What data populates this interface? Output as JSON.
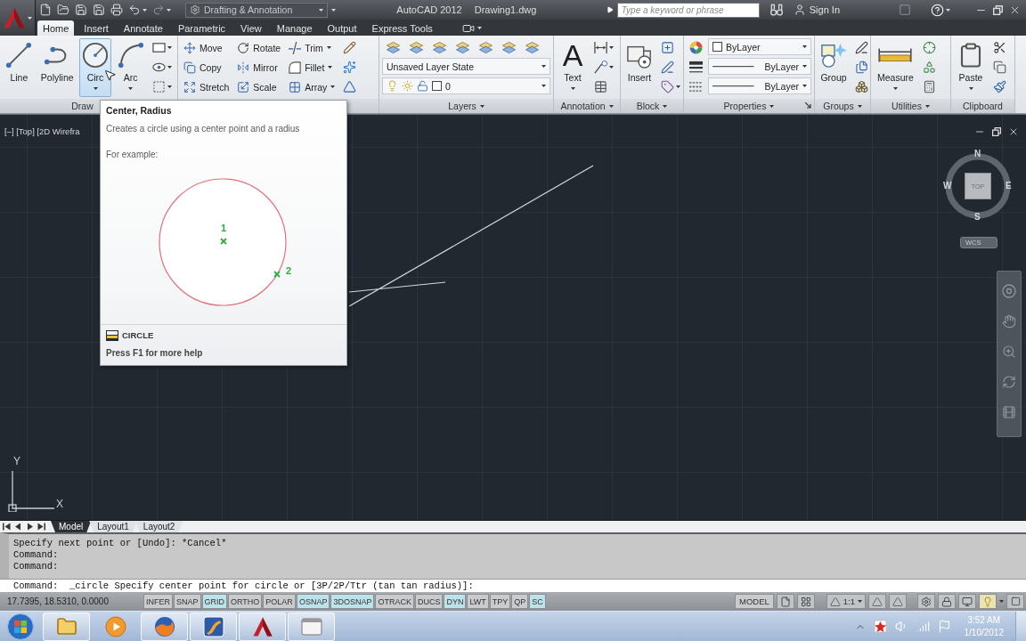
{
  "title_bar": {
    "workspace": "Drafting & Annotation",
    "app_name": "AutoCAD 2012",
    "document": "Drawing1.dwg",
    "search": {
      "placeholder": "Type a keyword or phrase"
    },
    "sign_in": "Sign In"
  },
  "tabs": [
    {
      "label": "Home",
      "selected": true
    },
    {
      "label": "Insert",
      "selected": false
    },
    {
      "label": "Annotate",
      "selected": false
    },
    {
      "label": "Parametric",
      "selected": false
    },
    {
      "label": "View",
      "selected": false
    },
    {
      "label": "Manage",
      "selected": false
    },
    {
      "label": "Output",
      "selected": false
    },
    {
      "label": "Express Tools",
      "selected": false
    }
  ],
  "ribbon": {
    "panels": [
      {
        "title": "Draw",
        "menu": false,
        "launcher": false,
        "large_buttons": [
          {
            "label": "Line",
            "menu": false,
            "hovered": false
          },
          {
            "label": "Polyline",
            "menu": false,
            "hovered": false
          },
          {
            "label": "Circ",
            "menu": true,
            "hovered": true
          },
          {
            "label": "Arc",
            "menu": true,
            "hovered": false
          }
        ],
        "tools": [
          [
            {
              "kind": "icon",
              "menu": true
            },
            {
              "kind": "icon",
              "menu": true
            },
            {
              "kind": "icon",
              "menu": true
            }
          ]
        ]
      },
      {
        "tools": [
          [
            {
              "kind": "tool",
              "label": "Move",
              "menu": false
            },
            {
              "kind": "tool",
              "label": "Copy",
              "menu": false
            },
            {
              "kind": "tool",
              "label": "Stretch",
              "menu": false
            }
          ],
          [
            {
              "kind": "tool",
              "label": "Rotate",
              "menu": false
            },
            {
              "kind": "tool",
              "label": "Mirror",
              "menu": false
            },
            {
              "kind": "tool",
              "label": "Scale",
              "menu": false
            }
          ],
          [
            {
              "kind": "tool",
              "label": "Trim",
              "menu": true
            },
            {
              "kind": "tool",
              "label": "Fillet",
              "menu": true
            },
            {
              "kind": "tool",
              "label": "Array",
              "menu": true
            }
          ],
          [
            {
              "kind": "icon",
              "menu": false
            },
            {
              "kind": "icon",
              "menu": false
            },
            {
              "kind": "icon",
              "menu": false
            }
          ]
        ]
      },
      {
        "title": "Layers",
        "menu": true,
        "launcher": false,
        "tools": [
          [
            {
              "kind": "icon_row",
              "items": [
                {
                  "menu": false
                },
                {
                  "menu": false
                },
                {
                  "menu": false
                },
                {
                  "menu": false
                },
                {
                  "menu": false
                },
                {
                  "menu": false
                },
                {
                  "menu": false
                }
              ]
            },
            {
              "kind": "select",
              "value": "Unsaved Layer State"
            },
            {
              "kind": "layer_select",
              "value": "0"
            }
          ]
        ]
      },
      {
        "title": "Annotation",
        "menu": true,
        "launcher": false,
        "large_buttons": [
          {
            "label": "Text",
            "glyph": "A",
            "menu": true,
            "hovered": false
          }
        ],
        "tools": [
          [
            {
              "kind": "icon",
              "menu": true
            },
            {
              "kind": "icon",
              "menu": true
            },
            {
              "kind": "icon",
              "menu": false
            }
          ]
        ]
      },
      {
        "title": "Block",
        "menu": true,
        "launcher": false,
        "large_buttons": [
          {
            "label": "Insert",
            "menu": false,
            "hovered": false
          }
        ],
        "tools": [
          [
            {
              "kind": "icon",
              "menu": false
            },
            {
              "kind": "icon",
              "menu": false
            },
            {
              "kind": "icon",
              "menu": true
            }
          ]
        ]
      },
      {
        "title": "Properties",
        "menu": true,
        "launcher": true,
        "tools": [
          [
            {
              "kind": "icon",
              "menu": false
            },
            {
              "kind": "icon",
              "menu": false
            },
            {
              "kind": "icon",
              "menu": false
            }
          ],
          [
            {
              "kind": "swatch_select",
              "value": "ByLayer"
            },
            {
              "kind": "line_select",
              "value": "ByLayer"
            },
            {
              "kind": "line_select",
              "value": "ByLayer"
            }
          ]
        ]
      },
      {
        "title": "Groups",
        "menu": true,
        "launcher": false,
        "large_buttons": [
          {
            "label": "Group",
            "menu": false,
            "hovered": false
          }
        ],
        "tools": [
          [
            {
              "kind": "icon",
              "menu": false
            },
            {
              "kind": "icon",
              "menu": false
            },
            {
              "kind": "icon",
              "menu": false
            }
          ]
        ]
      },
      {
        "title": "Utilities",
        "menu": true,
        "launcher": false,
        "large_buttons": [
          {
            "label": "Measure",
            "menu": true,
            "hovered": false
          }
        ],
        "tools": [
          [
            {
              "kind": "icon",
              "menu": false
            },
            {
              "kind": "icon",
              "menu": false
            },
            {
              "kind": "icon",
              "menu": false
            }
          ]
        ]
      },
      {
        "title": "Clipboard",
        "menu": false,
        "launcher": false,
        "large_buttons": [
          {
            "label": "Paste",
            "menu": true,
            "hovered": false
          }
        ],
        "tools": [
          [
            {
              "kind": "icon",
              "menu": false
            },
            {
              "kind": "icon",
              "menu": false
            },
            {
              "kind": "icon",
              "menu": false
            }
          ]
        ]
      }
    ]
  },
  "tooltip": {
    "title": "Center, Radius",
    "description": "Creates a circle using a center point and a radius",
    "example_caption": "For example:",
    "point_labels": [
      "1",
      "2"
    ],
    "command": "CIRCLE",
    "help": "Press F1 for more help"
  },
  "canvas": {
    "viewport_label": "[–] [Top] [2D Wirefra",
    "viewcube": {
      "face": "TOP",
      "north": "N",
      "east": "E",
      "south": "S",
      "west": "W"
    },
    "coordinate_system": "WCS",
    "ucs": {
      "y_label": "Y",
      "x_label": "X"
    }
  },
  "layout_tabs": [
    {
      "label": "Model",
      "selected": true
    },
    {
      "label": "Layout1",
      "selected": false
    },
    {
      "label": "Layout2",
      "selected": false
    }
  ],
  "command_line": {
    "history": [
      "Specify next point or [Undo]: *Cancel*",
      "Command:",
      "Command:"
    ],
    "input": "Command:  _circle Specify center point for circle or [3P/2P/Ttr (tan tan radius)]:"
  },
  "status_bar": {
    "coordinates": "17.7395, 18.5310, 0.0000",
    "toggles": [
      {
        "label": "INFER",
        "on": false
      },
      {
        "label": "SNAP",
        "on": false
      },
      {
        "label": "GRID",
        "on": true
      },
      {
        "label": "ORTHO",
        "on": false
      },
      {
        "label": "POLAR",
        "on": false
      },
      {
        "label": "OSNAP",
        "on": true
      },
      {
        "label": "3DOSNAP",
        "on": true
      },
      {
        "label": "OTRACK",
        "on": false
      },
      {
        "label": "DUCS",
        "on": false
      },
      {
        "label": "DYN",
        "on": true
      },
      {
        "label": "LWT",
        "on": false
      },
      {
        "label": "TPY",
        "on": false
      },
      {
        "label": "QP",
        "on": false
      },
      {
        "label": "SC",
        "on": true
      }
    ],
    "space": "MODEL",
    "annotation_scale": "1:1",
    "isolation_on": true
  },
  "taskbar": {
    "apps": [
      {
        "running": true
      },
      {
        "running": false
      },
      {
        "running": true
      },
      {
        "running": true
      },
      {
        "running": true
      },
      {
        "running": true
      }
    ],
    "time": "3:52 AM",
    "date": "1/10/2012"
  }
}
